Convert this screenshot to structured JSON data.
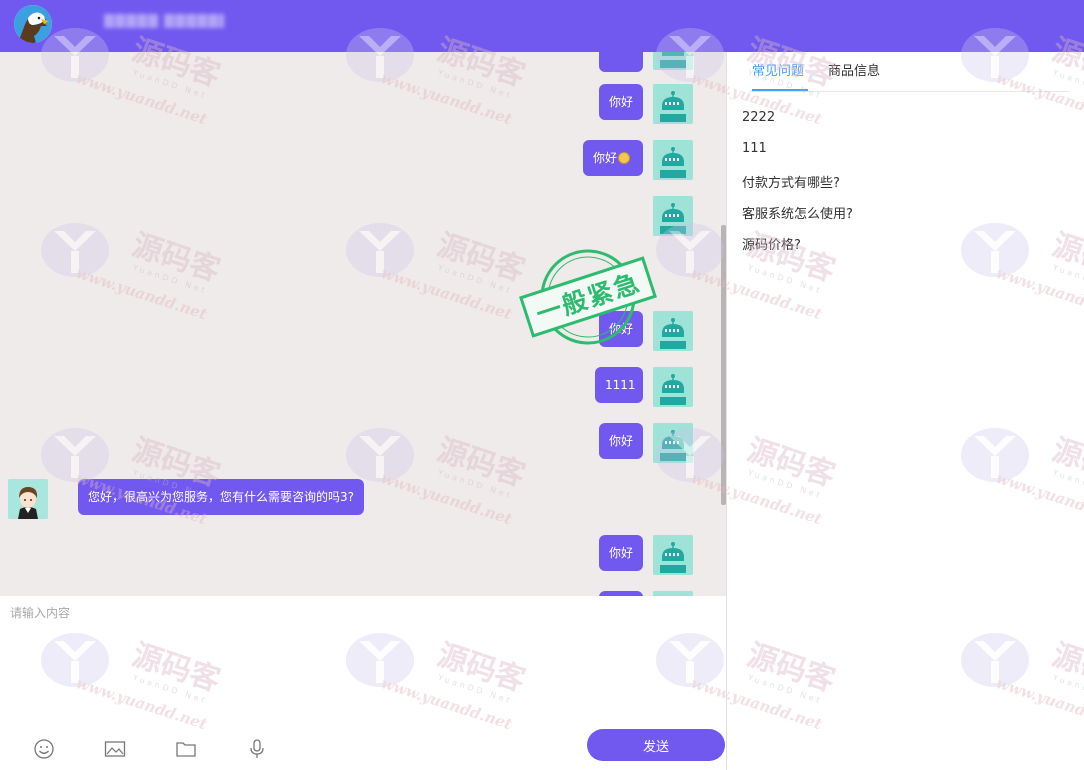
{
  "colors": {
    "accent": "#7159f0",
    "bot_avatar_bg": "#9fe3d8",
    "bot_teal": "#1fa9a0",
    "stamp_green": "#2dbb6f",
    "tab_active": "#409eff"
  },
  "header": {
    "title": "▓▓▓▓▓ ▓▓▓▓▓▓"
  },
  "messages": {
    "m1": {
      "text": ""
    },
    "m2": {
      "text": "你好"
    },
    "m3": {
      "text": "你好"
    },
    "m5": {
      "text": "你好"
    },
    "m6": {
      "text": "1111"
    },
    "m7": {
      "text": "你好"
    },
    "agent": {
      "text": "您好，很高兴为您服务，您有什么需要咨询的吗3?"
    },
    "m8": {
      "text": "你好"
    }
  },
  "stamp": {
    "text": "一般紧急"
  },
  "composer": {
    "placeholder": "请输入内容",
    "send_label": "发送"
  },
  "toolbar": {
    "icons": [
      "emoji-icon",
      "image-icon",
      "folder-icon",
      "microphone-icon"
    ]
  },
  "side": {
    "tabs": [
      {
        "label": "常见问题",
        "active": true
      },
      {
        "label": "商品信息",
        "active": false
      }
    ],
    "faq": [
      "2222",
      "111",
      "付款方式有哪些?",
      "客服系统怎么使用?",
      "源码价格?"
    ]
  },
  "watermark": {
    "brand": "源码客",
    "sub": "YuanDD Net",
    "url": "www.yuandd.net"
  }
}
